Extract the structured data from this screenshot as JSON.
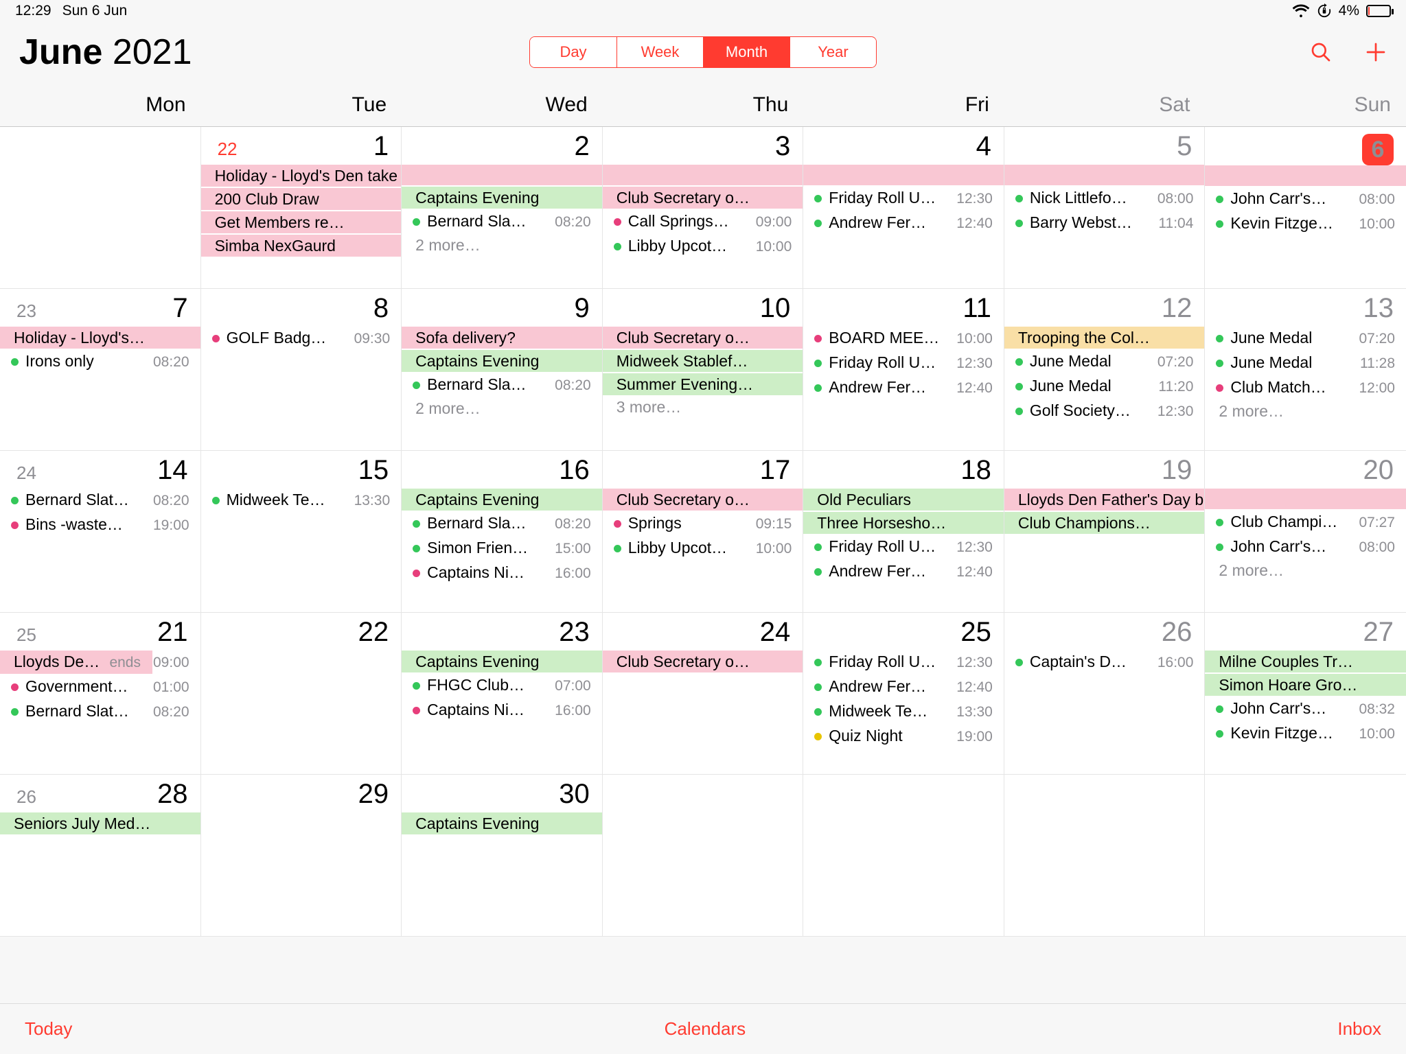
{
  "status": {
    "time": "12:29",
    "date": "Sun 6 Jun",
    "battery_pct": "4%"
  },
  "header": {
    "month": "June",
    "year": "2021",
    "seg_day": "Day",
    "seg_week": "Week",
    "seg_month": "Month",
    "seg_year": "Year"
  },
  "weekdays": [
    "Mon",
    "Tue",
    "Wed",
    "Thu",
    "Fri",
    "Sat",
    "Sun"
  ],
  "cells": [
    {
      "iso": "22",
      "iso_red": true,
      "day": "1",
      "events": [
        {
          "style": "pink",
          "text": "Holiday - Lloyd's Den take slow cooker"
        },
        {
          "style": "pink",
          "text": "200 Club Draw"
        },
        {
          "style": "pink",
          "text": "Get Members re…"
        },
        {
          "style": "pink",
          "text": "Simba NexGaurd"
        }
      ]
    },
    {
      "day": "2",
      "events": [
        {
          "style": "pink",
          "text": ""
        },
        {
          "style": "green",
          "text": "Captains Evening"
        },
        {
          "style": "dot",
          "dot": "green",
          "text": "Bernard Sla…",
          "time": "08:20"
        },
        {
          "style": "more",
          "text": "2 more…"
        }
      ]
    },
    {
      "day": "3",
      "events": [
        {
          "style": "pink",
          "text": ""
        },
        {
          "style": "pink",
          "text": "Club Secretary o…"
        },
        {
          "style": "dot",
          "dot": "pink",
          "text": "Call Springs…",
          "time": "09:00"
        },
        {
          "style": "dot",
          "dot": "green",
          "text": "Libby Upcot…",
          "time": "10:00"
        }
      ]
    },
    {
      "day": "4",
      "events": [
        {
          "style": "pink",
          "text": ""
        },
        {
          "style": "dot",
          "dot": "green",
          "text": "Friday Roll U…",
          "time": "12:30"
        },
        {
          "style": "dot",
          "dot": "green",
          "text": "Andrew Fer…",
          "time": "12:40"
        }
      ]
    },
    {
      "day": "5",
      "weekend": true,
      "events": [
        {
          "style": "pink",
          "text": ""
        },
        {
          "style": "dot",
          "dot": "green",
          "text": "Nick Littlefo…",
          "time": "08:00"
        },
        {
          "style": "dot",
          "dot": "green",
          "text": "Barry Webst…",
          "time": "11:04"
        }
      ]
    },
    {
      "day": "6",
      "today": true,
      "weekend": true,
      "events": [
        {
          "style": "pink",
          "text": ""
        },
        {
          "style": "dot",
          "dot": "green",
          "text": "John Carr's…",
          "time": "08:00"
        },
        {
          "style": "dot",
          "dot": "green",
          "text": "Kevin  Fitzge…",
          "time": "10:00"
        }
      ]
    },
    {
      "iso": "23",
      "day": "7",
      "events": [
        {
          "style": "pink",
          "text": "Holiday - Lloyd's…"
        },
        {
          "style": "dot",
          "dot": "green",
          "text": "Irons only",
          "time": "08:20"
        }
      ]
    },
    {
      "day": "8",
      "events": [
        {
          "style": "dot",
          "dot": "pink",
          "text": "GOLF Badg…",
          "time": "09:30"
        }
      ]
    },
    {
      "day": "9",
      "events": [
        {
          "style": "pink",
          "text": "Sofa delivery?"
        },
        {
          "style": "green",
          "text": "Captains Evening"
        },
        {
          "style": "dot",
          "dot": "green",
          "text": "Bernard Sla…",
          "time": "08:20"
        },
        {
          "style": "more",
          "text": "2 more…"
        }
      ]
    },
    {
      "day": "10",
      "events": [
        {
          "style": "pink",
          "text": "Club Secretary o…"
        },
        {
          "style": "green",
          "text": "Midweek Stablef…"
        },
        {
          "style": "green",
          "text": "Summer Evening…"
        },
        {
          "style": "more",
          "text": "3 more…"
        }
      ]
    },
    {
      "day": "11",
      "events": [
        {
          "style": "dot",
          "dot": "pink",
          "text": "BOARD MEE…",
          "time": "10:00"
        },
        {
          "style": "dot",
          "dot": "green",
          "text": "Friday Roll U…",
          "time": "12:30"
        },
        {
          "style": "dot",
          "dot": "green",
          "text": "Andrew Fer…",
          "time": "12:40"
        }
      ]
    },
    {
      "day": "12",
      "weekend": true,
      "events": [
        {
          "style": "orange",
          "text": "Trooping the Col…"
        },
        {
          "style": "dot",
          "dot": "green",
          "text": "June Medal",
          "time": "07:20"
        },
        {
          "style": "dot",
          "dot": "green",
          "text": "June Medal",
          "time": "11:20"
        },
        {
          "style": "dot",
          "dot": "green",
          "text": "Golf Society…",
          "time": "12:30"
        }
      ]
    },
    {
      "day": "13",
      "weekend": true,
      "events": [
        {
          "style": "dot",
          "dot": "green",
          "text": "June Medal",
          "time": "07:20"
        },
        {
          "style": "dot",
          "dot": "green",
          "text": "June Medal",
          "time": "11:28"
        },
        {
          "style": "dot",
          "dot": "pink",
          "text": "Club Match…",
          "time": "12:00"
        },
        {
          "style": "more",
          "text": "2 more…"
        }
      ]
    },
    {
      "iso": "24",
      "day": "14",
      "events": [
        {
          "style": "dot",
          "dot": "green",
          "text": "Bernard Slat…",
          "time": "08:20"
        },
        {
          "style": "dot",
          "dot": "pink",
          "text": "Bins -waste…",
          "time": "19:00"
        }
      ]
    },
    {
      "day": "15",
      "events": [
        {
          "style": "dot",
          "dot": "green",
          "text": "Midweek Te…",
          "time": "13:30"
        }
      ]
    },
    {
      "day": "16",
      "events": [
        {
          "style": "green",
          "text": "Captains Evening"
        },
        {
          "style": "dot",
          "dot": "green",
          "text": "Bernard Sla…",
          "time": "08:20"
        },
        {
          "style": "dot",
          "dot": "green",
          "text": "Simon Frien…",
          "time": "15:00"
        },
        {
          "style": "dot",
          "dot": "pink",
          "text": "Captains Ni…",
          "time": "16:00"
        }
      ]
    },
    {
      "day": "17",
      "events": [
        {
          "style": "pink",
          "text": "Club Secretary o…"
        },
        {
          "style": "dot",
          "dot": "pink",
          "text": "Springs",
          "time": "09:15"
        },
        {
          "style": "dot",
          "dot": "green",
          "text": "Libby Upcot…",
          "time": "10:00"
        }
      ]
    },
    {
      "day": "18",
      "events": [
        {
          "style": "green",
          "text": "Old Peculiars"
        },
        {
          "style": "green",
          "text": "Three Horsesho…"
        },
        {
          "style": "dot",
          "dot": "green",
          "text": "Friday Roll U…",
          "time": "12:30"
        },
        {
          "style": "dot",
          "dot": "green",
          "text": "Andrew Fer…",
          "time": "12:40"
        }
      ]
    },
    {
      "day": "19",
      "weekend": true,
      "events": [
        {
          "style": "pink",
          "text": "Lloyds Den Father's Day bar-b-q"
        },
        {
          "style": "green",
          "text": "Club Champions…"
        }
      ]
    },
    {
      "day": "20",
      "weekend": true,
      "events": [
        {
          "style": "pink",
          "text": ""
        },
        {
          "style": "dot",
          "dot": "green",
          "text": "Club Champi…",
          "time": "07:27"
        },
        {
          "style": "dot",
          "dot": "green",
          "text": "John Carr's…",
          "time": "08:00"
        },
        {
          "style": "more",
          "text": "2 more…"
        }
      ]
    },
    {
      "iso": "25",
      "day": "21",
      "events": [
        {
          "style": "pink-ends",
          "text": "Lloyds Den Father's Day bar-…",
          "endlabel": "ends",
          "time": "09:00"
        },
        {
          "style": "dot",
          "dot": "pink",
          "text": "Government…",
          "time": "01:00"
        },
        {
          "style": "dot",
          "dot": "green",
          "text": "Bernard Slat…",
          "time": "08:20"
        }
      ]
    },
    {
      "day": "22",
      "events": []
    },
    {
      "day": "23",
      "events": [
        {
          "style": "green",
          "text": "Captains Evening"
        },
        {
          "style": "dot",
          "dot": "green",
          "text": "FHGC Club…",
          "time": "07:00"
        },
        {
          "style": "dot",
          "dot": "pink",
          "text": "Captains Ni…",
          "time": "16:00"
        }
      ]
    },
    {
      "day": "24",
      "events": [
        {
          "style": "pink",
          "text": "Club Secretary o…"
        }
      ]
    },
    {
      "day": "25",
      "events": [
        {
          "style": "dot",
          "dot": "green",
          "text": "Friday Roll U…",
          "time": "12:30"
        },
        {
          "style": "dot",
          "dot": "green",
          "text": "Andrew Fer…",
          "time": "12:40"
        },
        {
          "style": "dot",
          "dot": "green",
          "text": "Midweek Te…",
          "time": "13:30"
        },
        {
          "style": "dot",
          "dot": "yellow",
          "text": "Quiz Night",
          "time": "19:00"
        }
      ]
    },
    {
      "day": "26",
      "weekend": true,
      "events": [
        {
          "style": "dot",
          "dot": "green",
          "text": "Captain's D…",
          "time": "16:00"
        }
      ]
    },
    {
      "day": "27",
      "weekend": true,
      "events": [
        {
          "style": "green",
          "text": "Milne Couples Tr…"
        },
        {
          "style": "green",
          "text": "Simon Hoare Gro…"
        },
        {
          "style": "dot",
          "dot": "green",
          "text": "John Carr's…",
          "time": "08:32"
        },
        {
          "style": "dot",
          "dot": "green",
          "text": "Kevin  Fitzge…",
          "time": "10:00"
        }
      ]
    },
    {
      "iso": "26",
      "day": "28",
      "events": [
        {
          "style": "green",
          "text": "Seniors July Med…",
          "clip": true
        }
      ]
    },
    {
      "day": "29",
      "events": []
    },
    {
      "day": "30",
      "events": [
        {
          "style": "green",
          "text": "Captains Evening",
          "clip": true
        }
      ]
    },
    {
      "day": "",
      "events": []
    },
    {
      "day": "",
      "events": []
    },
    {
      "day": "",
      "weekend": true,
      "events": []
    },
    {
      "day": "",
      "weekend": true,
      "events": []
    }
  ],
  "toolbar": {
    "today": "Today",
    "calendars": "Calendars",
    "inbox": "Inbox"
  }
}
